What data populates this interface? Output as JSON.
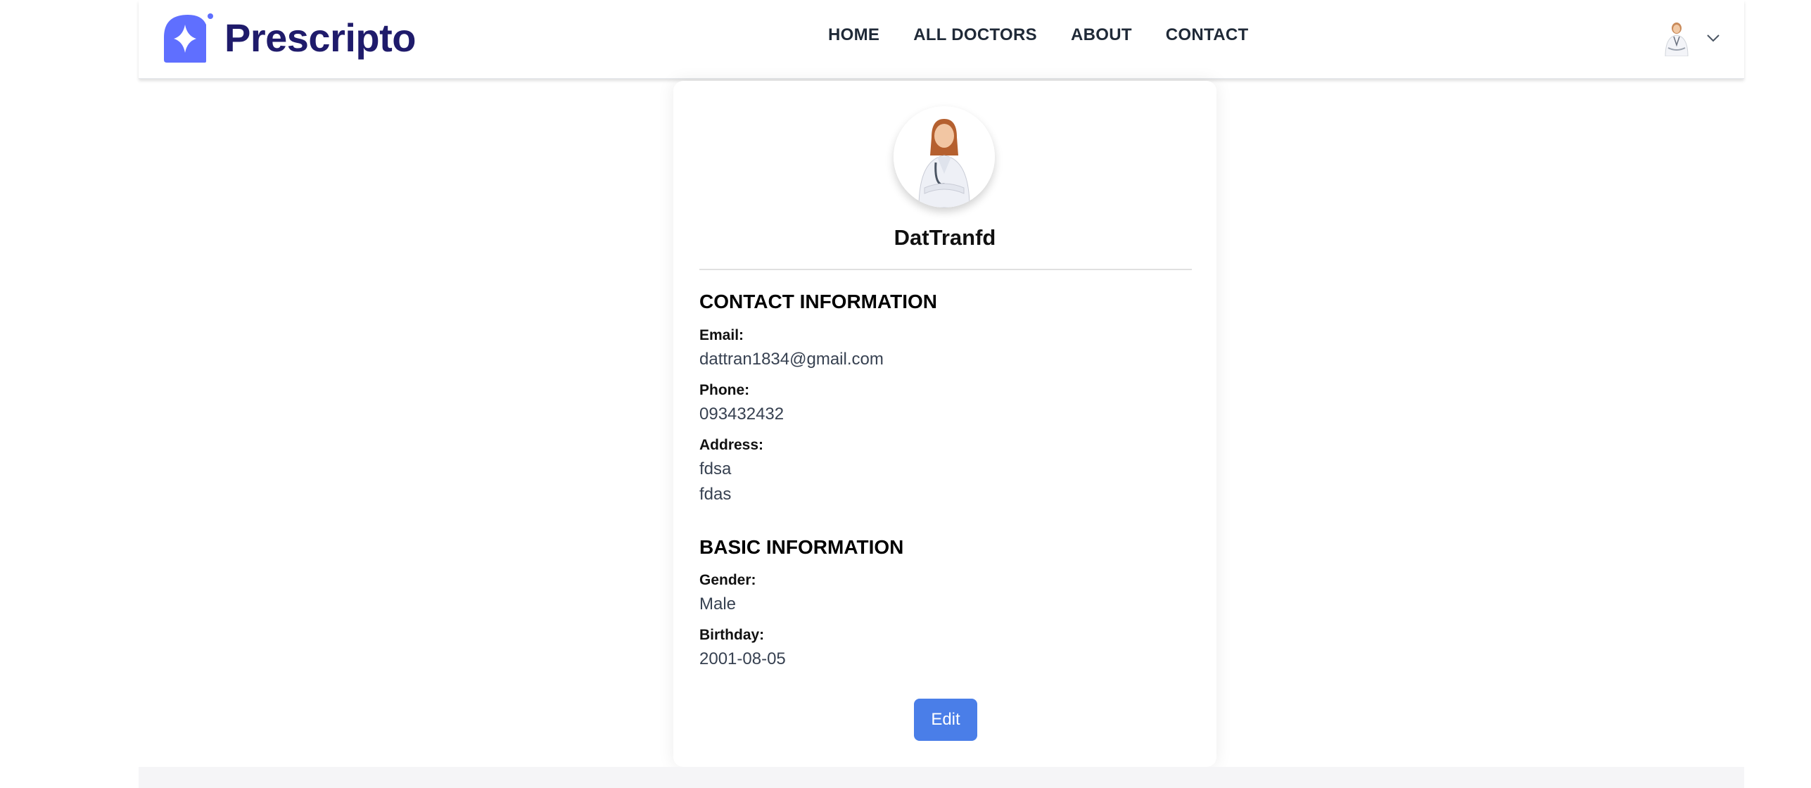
{
  "brand": {
    "name": "Prescripto",
    "color": "#5f6fff"
  },
  "nav": {
    "links": [
      "HOME",
      "ALL DOCTORS",
      "ABOUT",
      "CONTACT"
    ],
    "user_avatar_icon": "doctor-avatar",
    "dropdown_icon": "chevron-down-icon"
  },
  "profile": {
    "name": "DatTranfd",
    "contact_title": "CONTACT INFORMATION",
    "email_label": "Email:",
    "email": "dattran1834@gmail.com",
    "phone_label": "Phone:",
    "phone": "093432432",
    "address_label": "Address:",
    "address_line1": "fdsa",
    "address_line2": "fdas",
    "basic_title": "BASIC INFORMATION",
    "gender_label": "Gender:",
    "gender": "Male",
    "birthday_label": "Birthday:",
    "birthday": "2001-08-05",
    "edit_label": "Edit"
  },
  "colors": {
    "accent": "#4a7ee8",
    "logo_text": "#1f1b6b"
  }
}
